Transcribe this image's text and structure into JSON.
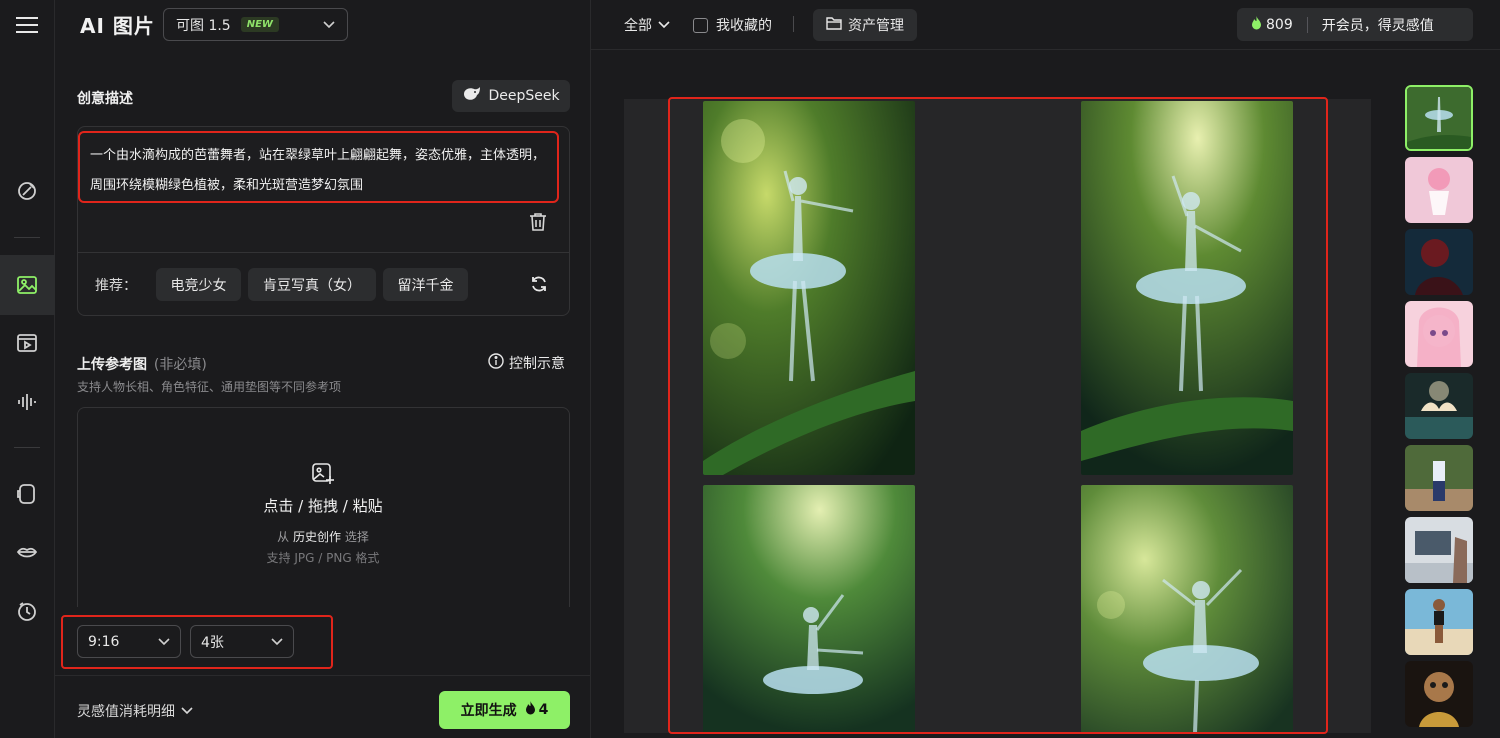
{
  "app": {
    "brand": "AI 图片",
    "model": "可图 1.5",
    "model_badge": "NEW"
  },
  "prompt": {
    "label": "创意描述",
    "deepseek_label": "DeepSeek",
    "text": "一个由水滴构成的芭蕾舞者，站在翠绿草叶上翩翩起舞，姿态优雅，主体透明，周围环绕模糊绿色植被，柔和光斑营造梦幻氛围",
    "recommend_label": "推荐：",
    "chips": [
      "电竞少女",
      "肯豆写真（女）",
      "留洋千金"
    ]
  },
  "upload": {
    "label": "上传参考图",
    "optional": "(非必填)",
    "sub": "支持人物长相、角色特征、通用垫图等不同参考项",
    "control_hint": "控制示意",
    "title": "点击 / 拖拽 / 粘贴",
    "from_prefix": "从",
    "from_link": "历史创作",
    "from_suffix": "选择",
    "formats": "支持 JPG / PNG 格式"
  },
  "settings": {
    "ratio": "9:16",
    "count": "4张"
  },
  "footer": {
    "cost_label": "灵感值消耗明细",
    "generate_label": "立即生成",
    "generate_cost": "4"
  },
  "topbar": {
    "filter_all": "全部",
    "favorites": "我收藏的",
    "assets": "资产管理",
    "credits": "809",
    "membership": "开会员，得灵感值"
  },
  "colors": {
    "accent": "#8ef067",
    "highlight": "#e0251b",
    "bg": "#1b1b1d"
  },
  "icons": [
    "menu-icon",
    "magic-pen-icon",
    "image-icon",
    "video-icon",
    "audio-icon",
    "avatar-icon",
    "lips-icon",
    "history-icon",
    "deepseek-whale-icon",
    "trash-icon",
    "refresh-icon",
    "info-icon",
    "upload-image-icon",
    "chevron-down-icon",
    "folder-icon",
    "flame-icon"
  ]
}
